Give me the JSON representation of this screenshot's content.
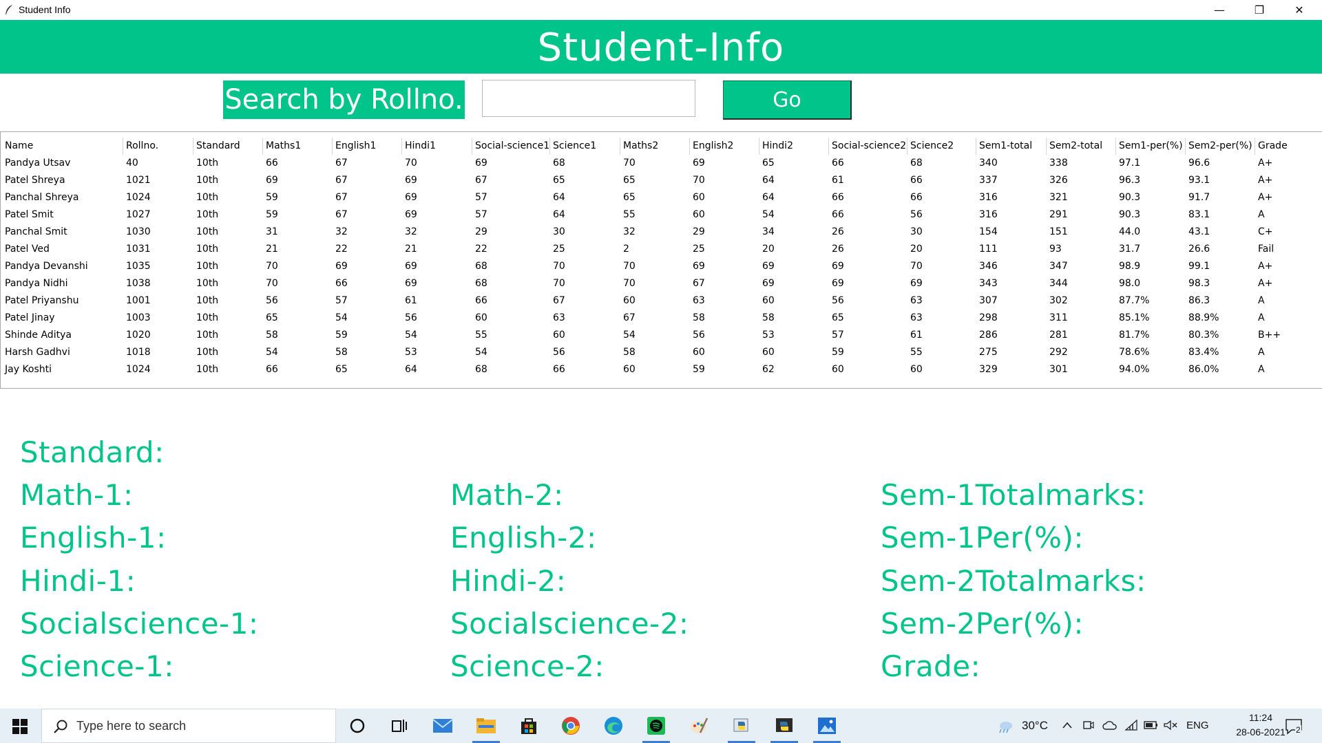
{
  "window": {
    "title": "Student Info",
    "min_glyph": "—",
    "max_glyph": "❐",
    "close_glyph": "✕"
  },
  "header": {
    "title": "Student-Info"
  },
  "search": {
    "label": "Search by Rollno.",
    "value": "",
    "placeholder": "",
    "go_label": "Go"
  },
  "colors": {
    "accent": "#00c48a",
    "white": "#ffffff",
    "taskbar": "#e6eef6"
  },
  "table": {
    "columns": [
      "Name",
      "Rollno.",
      "Standard",
      "Maths1",
      "English1",
      "Hindi1",
      "Social-science1",
      "Science1",
      "Maths2",
      "English2",
      "Hindi2",
      "Social-science2",
      "Science2",
      "Sem1-total",
      "Sem2-total",
      "Sem1-per(%)",
      "Sem2-per(%)",
      "Grade"
    ],
    "rows": [
      [
        "Pandya Utsav",
        "40",
        "10th",
        "66",
        "67",
        "70",
        "69",
        "68",
        "70",
        "69",
        "65",
        "66",
        "68",
        "340",
        "338",
        "97.1",
        "96.6",
        "A+"
      ],
      [
        "Patel Shreya",
        "1021",
        "10th",
        "69",
        "67",
        "69",
        "67",
        "65",
        "65",
        "70",
        "64",
        "61",
        "66",
        "337",
        "326",
        "96.3",
        "93.1",
        "A+"
      ],
      [
        "Panchal Shreya",
        "1024",
        "10th",
        "59",
        "67",
        "69",
        "57",
        "64",
        "65",
        "60",
        "64",
        "66",
        "66",
        "316",
        "321",
        "90.3",
        "91.7",
        "A+"
      ],
      [
        "Patel Smit",
        "1027",
        "10th",
        "59",
        "67",
        "69",
        "57",
        "64",
        "55",
        "60",
        "54",
        "66",
        "56",
        "316",
        "291",
        "90.3",
        "83.1",
        "A"
      ],
      [
        "Panchal Smit",
        "1030",
        "10th",
        "31",
        "32",
        "32",
        "29",
        "30",
        "32",
        "29",
        "34",
        "26",
        "30",
        "154",
        "151",
        "44.0",
        "43.1",
        "C+"
      ],
      [
        "Patel Ved",
        "1031",
        "10th",
        "21",
        "22",
        "21",
        "22",
        "25",
        "2",
        "25",
        "20",
        "26",
        "20",
        "111",
        "93",
        "31.7",
        "26.6",
        "Fail"
      ],
      [
        "Pandya Devanshi",
        "1035",
        "10th",
        "70",
        "69",
        "69",
        "68",
        "70",
        "70",
        "69",
        "69",
        "69",
        "70",
        "346",
        "347",
        "98.9",
        "99.1",
        "A+"
      ],
      [
        "Pandya Nidhi",
        "1038",
        "10th",
        "70",
        "66",
        "69",
        "68",
        "70",
        "70",
        "67",
        "69",
        "69",
        "69",
        "343",
        "344",
        "98.0",
        "98.3",
        "A+"
      ],
      [
        "Patel Priyanshu",
        "1001",
        "10th",
        "56",
        "57",
        "61",
        "66",
        "67",
        "60",
        "63",
        "60",
        "56",
        "63",
        "307",
        "302",
        "87.7%",
        "86.3",
        "A"
      ],
      [
        "Patel Jinay",
        "1003",
        "10th",
        "65",
        "54",
        "56",
        "60",
        "63",
        "67",
        "58",
        "58",
        "65",
        "63",
        "298",
        "311",
        "85.1%",
        "88.9%",
        "A"
      ],
      [
        "Shinde Aditya",
        "1020",
        "10th",
        "58",
        "59",
        "54",
        "55",
        "60",
        "54",
        "56",
        "53",
        "57",
        "61",
        "286",
        "281",
        "81.7%",
        "80.3%",
        "B++"
      ],
      [
        "Harsh Gadhvi",
        "1018",
        "10th",
        "54",
        "58",
        "53",
        "54",
        "56",
        "58",
        "60",
        "60",
        "59",
        "55",
        "275",
        "292",
        "78.6%",
        "83.4%",
        "A"
      ],
      [
        "Jay Koshti",
        "1024",
        "10th",
        "66",
        "65",
        "64",
        "68",
        "66",
        "60",
        "59",
        "62",
        "60",
        "60",
        "329",
        "301",
        "94.0%",
        "86.0%",
        "A"
      ]
    ]
  },
  "details": {
    "standard": "Standard:",
    "math1": "Math-1:",
    "english1": "English-1:",
    "hindi1": "Hindi-1:",
    "socialscience1": "Socialscience-1:",
    "science1": "Science-1:",
    "math2": "Math-2:",
    "english2": "English-2:",
    "hindi2": "Hindi-2:",
    "socialscience2": "Socialscience-2:",
    "science2": "Science-2:",
    "sem1total": "Sem-1Totalmarks:",
    "sem1per": "Sem-1Per(%):",
    "sem2total": "Sem-2Totalmarks:",
    "sem2per": "Sem-2Per(%):",
    "grade": "Grade:"
  },
  "taskbar": {
    "search_placeholder": "Type here to search",
    "temperature": "30°C",
    "language": "ENG",
    "time": "11:24",
    "date": "28-06-2021",
    "notifications": "2",
    "apps": [
      "cortana-icon",
      "task-view-icon",
      "mail-icon",
      "file-explorer-icon",
      "store-icon",
      "chrome-icon",
      "edge-icon",
      "spotify-icon",
      "paint-icon",
      "python-idle-icon",
      "python-app-icon",
      "photos-icon"
    ]
  }
}
